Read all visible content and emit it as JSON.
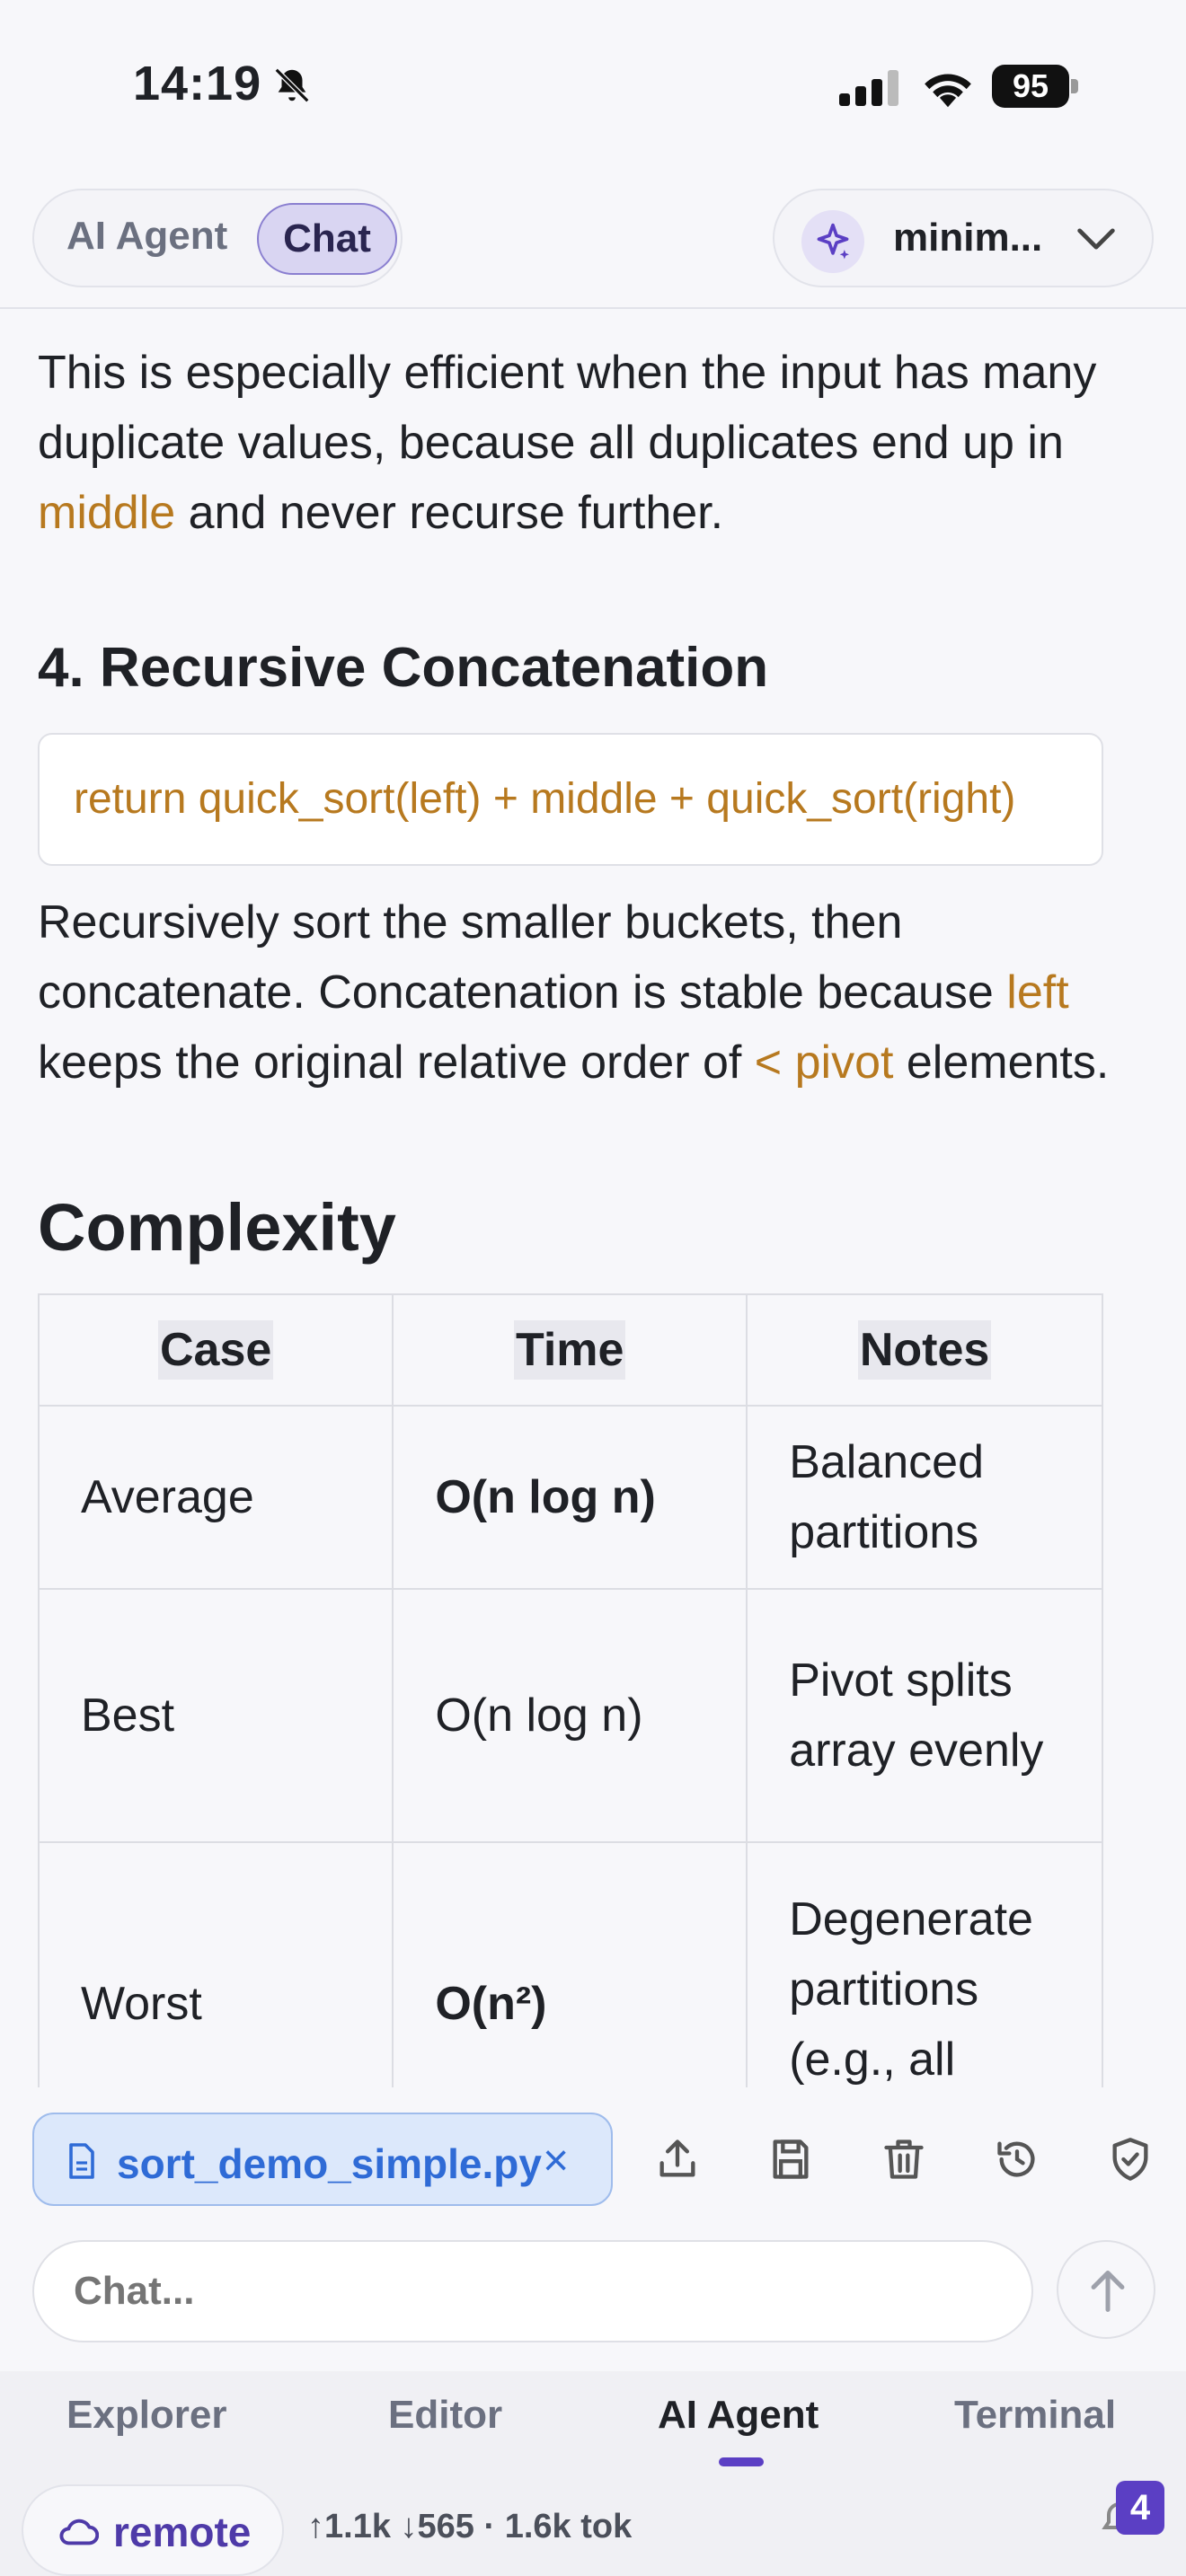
{
  "status": {
    "time": "14:19",
    "battery": "95"
  },
  "header": {
    "mode_agent": "AI Agent",
    "mode_chat": "Chat",
    "model": "minim..."
  },
  "message": {
    "p1_a": "This is especially efficient when the input has many duplicate values, because all duplicates end up in ",
    "p1_code": "middle",
    "p1_b": " and never recurse further.",
    "h3": "4. Recursive Concatenation",
    "code": "return quick_sort(left) + middle + quick_sort(right)",
    "p2_a": "Recursively sort the smaller buckets, then concatenate. Concatenation is stable because ",
    "p2_code1": "left",
    "p2_b": " keeps the original relative order of ",
    "p2_code2": "< pivot",
    "p2_c": " elements.",
    "h2": "Complexity",
    "table": {
      "headers": [
        "Case",
        "Time",
        "Notes"
      ],
      "rows": [
        [
          "Average",
          "O(n log n)",
          "Balanced partitions"
        ],
        [
          "Best",
          "O(n log n)",
          "Pivot splits array evenly"
        ],
        [
          "Worst",
          "O(n²)",
          "Degenerate partitions (e.g., all"
        ]
      ]
    }
  },
  "attachment": {
    "file": "sort_demo_simple.py",
    "close": "×"
  },
  "chat": {
    "placeholder": "Chat..."
  },
  "nav": {
    "tabs": [
      "Explorer",
      "Editor",
      "AI Agent",
      "Terminal"
    ],
    "active": "AI Agent"
  },
  "footer": {
    "remote": "remote",
    "stats": "↑1.1k ↓565 · 1.6k tok",
    "notifications": "4"
  },
  "colors": {
    "accent": "#5b3fc4",
    "inline_code": "#b7791f",
    "file_chip": "#2f6bd6"
  }
}
